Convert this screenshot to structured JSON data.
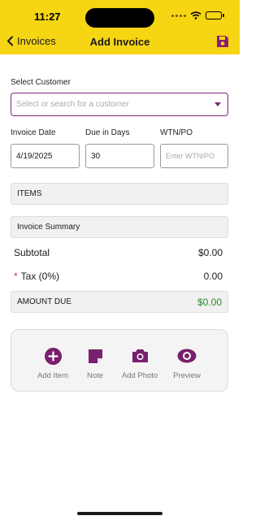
{
  "status_bar": {
    "time": "11:27"
  },
  "header": {
    "back_label": "Invoices",
    "title": "Add Invoice"
  },
  "customer": {
    "label": "Select Customer",
    "placeholder": "Select or search for a customer"
  },
  "invoice_date": {
    "label": "Invoice Date",
    "value": "4/19/2025"
  },
  "due_days": {
    "label": "Due in Days",
    "value": "30"
  },
  "wtn": {
    "label": "WTN/PO",
    "placeholder": "Enter WTN/PO"
  },
  "sections": {
    "items": "ITEMS",
    "summary": "Invoice Summary"
  },
  "totals": {
    "subtotal_label": "Subtotal",
    "subtotal_value": "$0.00",
    "tax_label": "Tax (0%)",
    "tax_value": "0.00",
    "amount_due_label": "AMOUNT DUE",
    "amount_due_value": "$0.00"
  },
  "actions": [
    {
      "label": "Add Item",
      "icon": "plus-circle-icon"
    },
    {
      "label": "Note",
      "icon": "note-icon"
    },
    {
      "label": "Add Photo",
      "icon": "camera-icon"
    },
    {
      "label": "Preview",
      "icon": "eye-icon"
    }
  ],
  "colors": {
    "header_bg": "#f6d513",
    "accent": "#7a2a7a",
    "amount_due": "#2a8a2a",
    "required": "#d83030"
  }
}
